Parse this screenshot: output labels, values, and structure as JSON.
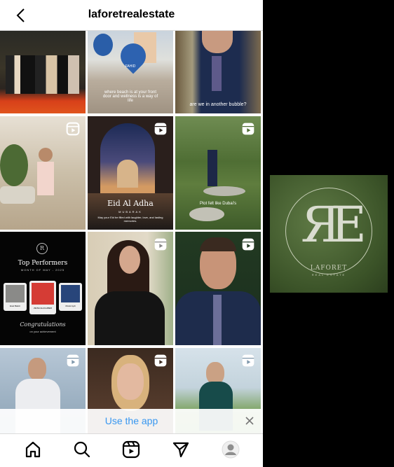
{
  "header": {
    "title": "laforetrealestate",
    "back_icon": "chevron-left-icon"
  },
  "posts": [
    {
      "type": "photo",
      "caption": ""
    },
    {
      "type": "photo",
      "caption": "where beach is at your front door and wellness is a way of life",
      "badge": "FAHID"
    },
    {
      "type": "photo",
      "caption": "are we in another bubble?"
    },
    {
      "type": "reel",
      "caption": ""
    },
    {
      "type": "reel",
      "title": "Eid Al Adha",
      "subtitle": "MUBARAK",
      "caption": "May your Eid be filled with laughter, love, and lasting memories."
    },
    {
      "type": "reel",
      "caption": "Plot felt like Dubai's"
    },
    {
      "type": "photo",
      "title": "Top Performers",
      "subtitle": "MONTH OF MAY - 2025",
      "people": [
        "Esat Bakici",
        "ZEINA ELAGHBER",
        "Murat Aydi"
      ],
      "footer": "Congratulations",
      "footer_sub": "on your achievement"
    },
    {
      "type": "reel",
      "caption": ""
    },
    {
      "type": "reel",
      "caption": ""
    },
    {
      "type": "reel",
      "caption": ""
    },
    {
      "type": "reel",
      "caption": ""
    },
    {
      "type": "reel",
      "caption": ""
    }
  ],
  "banner": {
    "link": "Use the app",
    "close_icon": "close-icon"
  },
  "nav": {
    "items": [
      "home",
      "search",
      "reels",
      "direct",
      "profile"
    ]
  },
  "logo": {
    "monogram": "RE",
    "name": "LAFORET",
    "tagline": "REAL ESTATE"
  },
  "colors": {
    "accent": "#3897f0"
  }
}
